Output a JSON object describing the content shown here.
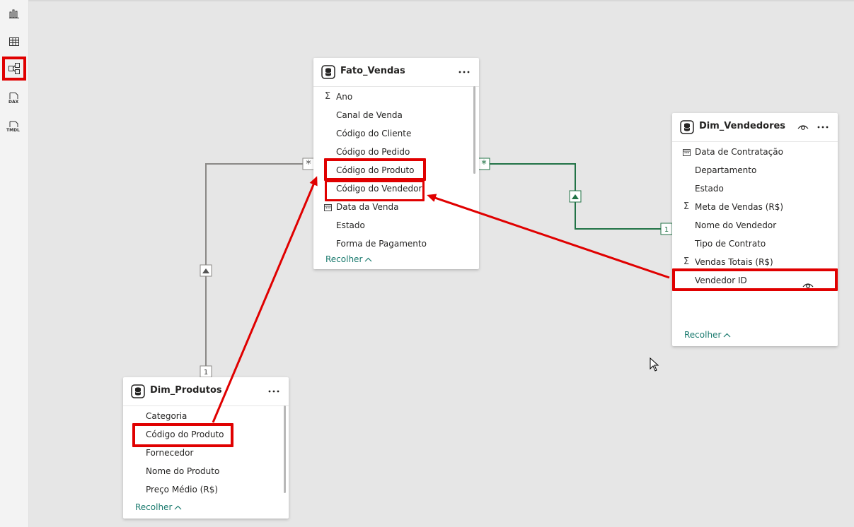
{
  "sidebar": {
    "items": [
      {
        "name": "report-view",
        "icon": "bar-chart-icon",
        "active": false
      },
      {
        "name": "table-view",
        "icon": "table-grid-icon",
        "active": false
      },
      {
        "name": "model-view",
        "icon": "model-diagram-icon",
        "active": true
      },
      {
        "name": "dax-query-view",
        "icon": "dax-icon",
        "label": "DAX",
        "active": false
      },
      {
        "name": "tmdl-view",
        "icon": "tmdl-icon",
        "label": "TMDL",
        "active": false
      }
    ]
  },
  "tables": {
    "fato_vendas": {
      "title": "Fato_Vendas",
      "fields": [
        {
          "label": "Ano",
          "icon": "sigma-icon"
        },
        {
          "label": "Canal de Venda",
          "icon": ""
        },
        {
          "label": "Código do Cliente",
          "icon": ""
        },
        {
          "label": "Código do Pedido",
          "icon": ""
        },
        {
          "label": "Código do Produto",
          "icon": ""
        },
        {
          "label": "Código do Vendedor",
          "icon": ""
        },
        {
          "label": "Data da Venda",
          "icon": "calendar-icon"
        },
        {
          "label": "Estado",
          "icon": ""
        },
        {
          "label": "Forma de Pagamento",
          "icon": ""
        }
      ],
      "collapse_label": "Recolher"
    },
    "dim_vendedores": {
      "title": "Dim_Vendedores",
      "fields": [
        {
          "label": "Data de Contratação",
          "icon": "calendar-icon"
        },
        {
          "label": "Departamento",
          "icon": ""
        },
        {
          "label": "Estado",
          "icon": ""
        },
        {
          "label": "Meta de Vendas (R$)",
          "icon": "sigma-icon"
        },
        {
          "label": "Nome do Vendedor",
          "icon": ""
        },
        {
          "label": "Tipo de Contrato",
          "icon": ""
        },
        {
          "label": "Vendas Totais (R$)",
          "icon": "sigma-icon"
        },
        {
          "label": "Vendedor ID",
          "icon": ""
        }
      ],
      "collapse_label": "Recolher"
    },
    "dim_produtos": {
      "title": "Dim_Produtos",
      "fields": [
        {
          "label": "Categoria",
          "icon": ""
        },
        {
          "label": "Código do Produto",
          "icon": ""
        },
        {
          "label": "Fornecedor",
          "icon": ""
        },
        {
          "label": "Nome do Produto",
          "icon": ""
        },
        {
          "label": "Preço Médio (R$)",
          "icon": ""
        }
      ],
      "collapse_label": "Recolher"
    }
  },
  "relationships": {
    "produtos_vendas": {
      "from_cardinality": "1",
      "to_cardinality": "*",
      "filter_direction": "single",
      "color": "#8a8886"
    },
    "vendedores_vendas": {
      "from_cardinality": "1",
      "to_cardinality": "*",
      "filter_direction": "single",
      "color": "#217346"
    }
  },
  "colors": {
    "canvas": "#e6e6e6",
    "highlight": "#e00000",
    "collapse_link": "#1a7a6e",
    "active_relationship": "#217346"
  }
}
